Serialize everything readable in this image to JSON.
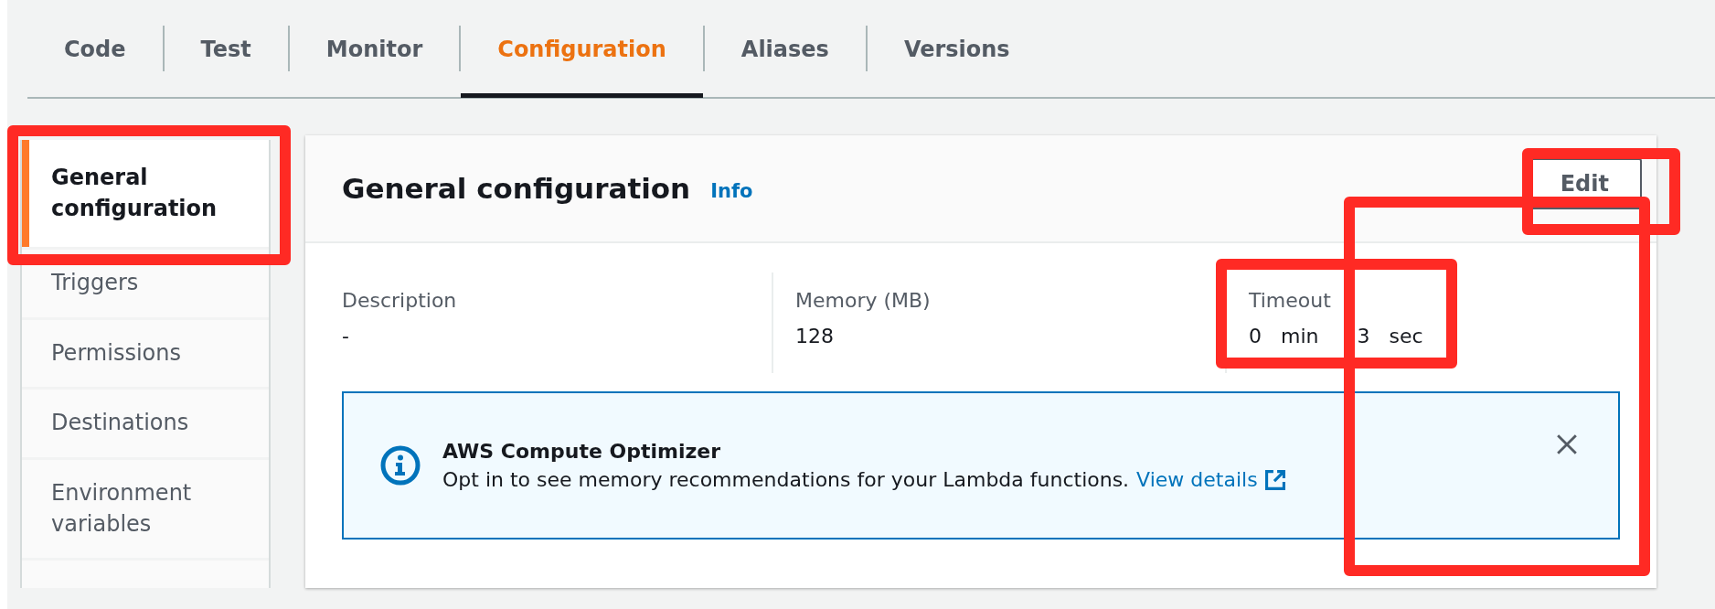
{
  "tabs": [
    {
      "label": "Code",
      "selected": false
    },
    {
      "label": "Test",
      "selected": false
    },
    {
      "label": "Monitor",
      "selected": false
    },
    {
      "label": "Configuration",
      "selected": true
    },
    {
      "label": "Aliases",
      "selected": false
    },
    {
      "label": "Versions",
      "selected": false
    }
  ],
  "sidebar": {
    "items": [
      {
        "label": "General configuration",
        "selected": true
      },
      {
        "label": "Triggers",
        "selected": false
      },
      {
        "label": "Permissions",
        "selected": false
      },
      {
        "label": "Destinations",
        "selected": false
      },
      {
        "label": "Environment variables",
        "selected": false
      }
    ]
  },
  "panel": {
    "title": "General configuration",
    "info_link": "Info",
    "edit_button": "Edit",
    "fields": [
      {
        "label": "Description",
        "value": "-"
      },
      {
        "label": "Memory (MB)",
        "value": "128"
      },
      {
        "label": "Timeout",
        "value": "0 min  3 sec"
      }
    ],
    "alert": {
      "title": "AWS Compute Optimizer",
      "message": "Opt in to see memory recommendations for your Lambda functions.",
      "link": "View details"
    }
  },
  "annotations": [
    {
      "kind": "highlight"
    },
    {
      "kind": "highlight"
    },
    {
      "kind": "highlight"
    },
    {
      "kind": "highlight"
    }
  ]
}
